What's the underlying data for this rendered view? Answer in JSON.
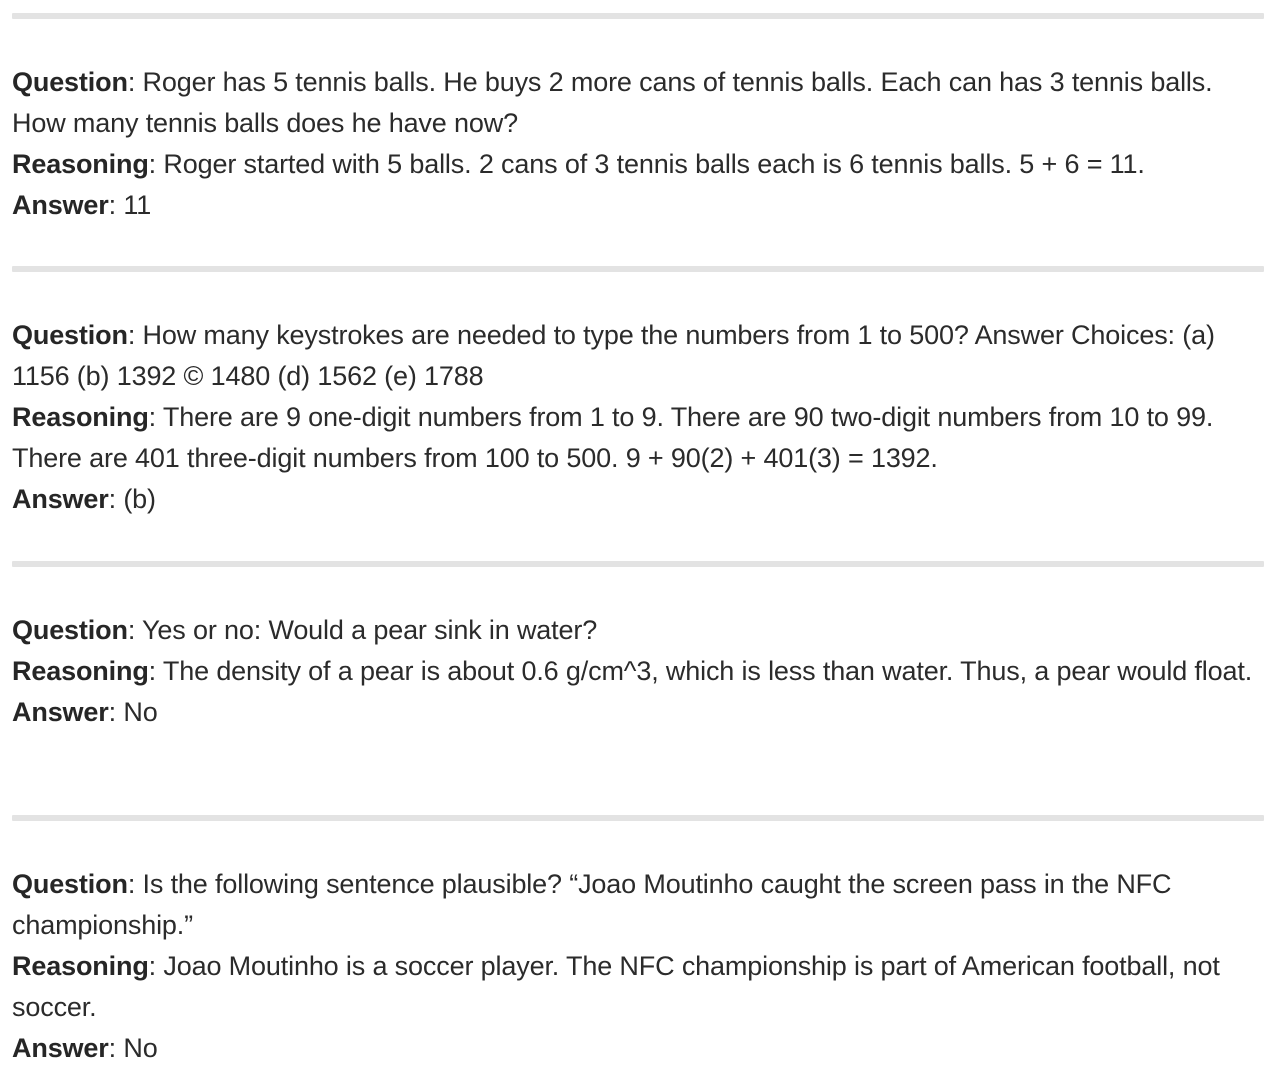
{
  "labels": {
    "question": "Question",
    "reasoning": "Reasoning",
    "answer": "Answer",
    "separator": ": "
  },
  "examples": [
    {
      "question": "Roger has 5 tennis balls. He buys 2 more cans of tennis balls. Each can has 3 tennis balls. How many tennis balls does he have now?",
      "reasoning": "Roger started with 5 balls. 2 cans of 3 tennis balls each is 6 tennis balls. 5 + 6 = 11.",
      "answer": "11"
    },
    {
      "question": "How many keystrokes are needed to type the numbers from 1 to 500? Answer Choices: (a) 1156 (b) 1392 © 1480 (d) 1562 (e) 1788",
      "reasoning": "There are 9 one-digit numbers from 1 to 9. There are 90 two-digit numbers from 10 to 99. There are 401 three-digit numbers from 100 to 500. 9 + 90(2) + 401(3) = 1392.",
      "answer": "(b)"
    },
    {
      "question": "Yes or no: Would a pear sink in water?",
      "reasoning": "The density of a pear is about 0.6 g/cm^3, which is less than water. Thus, a pear would float.",
      "answer": "No"
    },
    {
      "question": "Is the following sentence plausible? “Joao Moutinho caught the screen pass in the NFC championship.”",
      "reasoning": "Joao Moutinho is a soccer player. The NFC championship is part of American football, not soccer.",
      "answer": "No"
    }
  ]
}
